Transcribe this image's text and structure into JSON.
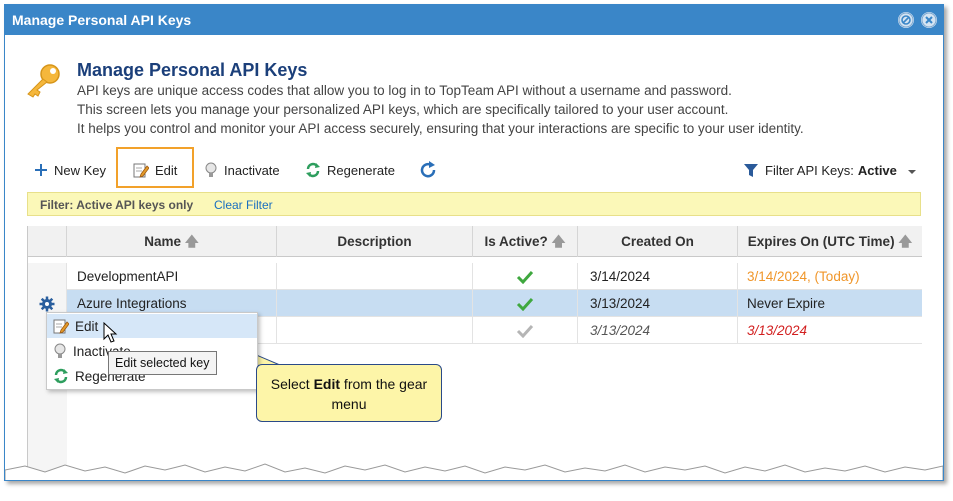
{
  "window": {
    "title": "Manage Personal API Keys"
  },
  "header": {
    "title": "Manage Personal API Keys",
    "lines": [
      "API keys are unique access codes that allow you to log in to TopTeam API without a username and password.",
      "This screen lets you manage your personalized API keys, which are specifically tailored to your user account.",
      "It helps you control and monitor your API access securely, ensuring that your interactions are specific to your user identity."
    ]
  },
  "toolbar": {
    "new_key": "New Key",
    "edit": "Edit",
    "inactivate": "Inactivate",
    "regenerate": "Regenerate",
    "filter_label": "Filter API Keys:",
    "filter_value": "Active"
  },
  "filter_bar": {
    "label": "Filter:  Active API keys only",
    "clear": "Clear Filter"
  },
  "grid": {
    "columns": [
      "Name",
      "Description",
      "Is Active?",
      "Created On",
      "Expires On (UTC Time)"
    ],
    "rows": [
      {
        "name": "DevelopmentAPI",
        "description": "",
        "active": "check-green",
        "created": "3/14/2024",
        "expires": "3/14/2024, (Today)"
      },
      {
        "name": "Azure Integrations",
        "description": "",
        "active": "check-green",
        "created": "3/13/2024",
        "expires": "Never Expire"
      },
      {
        "name": "",
        "description": "",
        "active": "check-gray",
        "created": "3/13/2024",
        "expires": "3/13/2024"
      }
    ]
  },
  "context_menu": {
    "items": [
      "Edit",
      "Inactivate",
      "Regenerate"
    ]
  },
  "tooltip": "Edit selected key",
  "callout": {
    "pre": "Select ",
    "bold": "Edit",
    "post": " from the gear menu"
  },
  "colors": {
    "titlebar": "#3a86c8",
    "accent_orange": "#f2a12a",
    "expired_red": "#d21f1f",
    "today_orange": "#f0962a"
  }
}
